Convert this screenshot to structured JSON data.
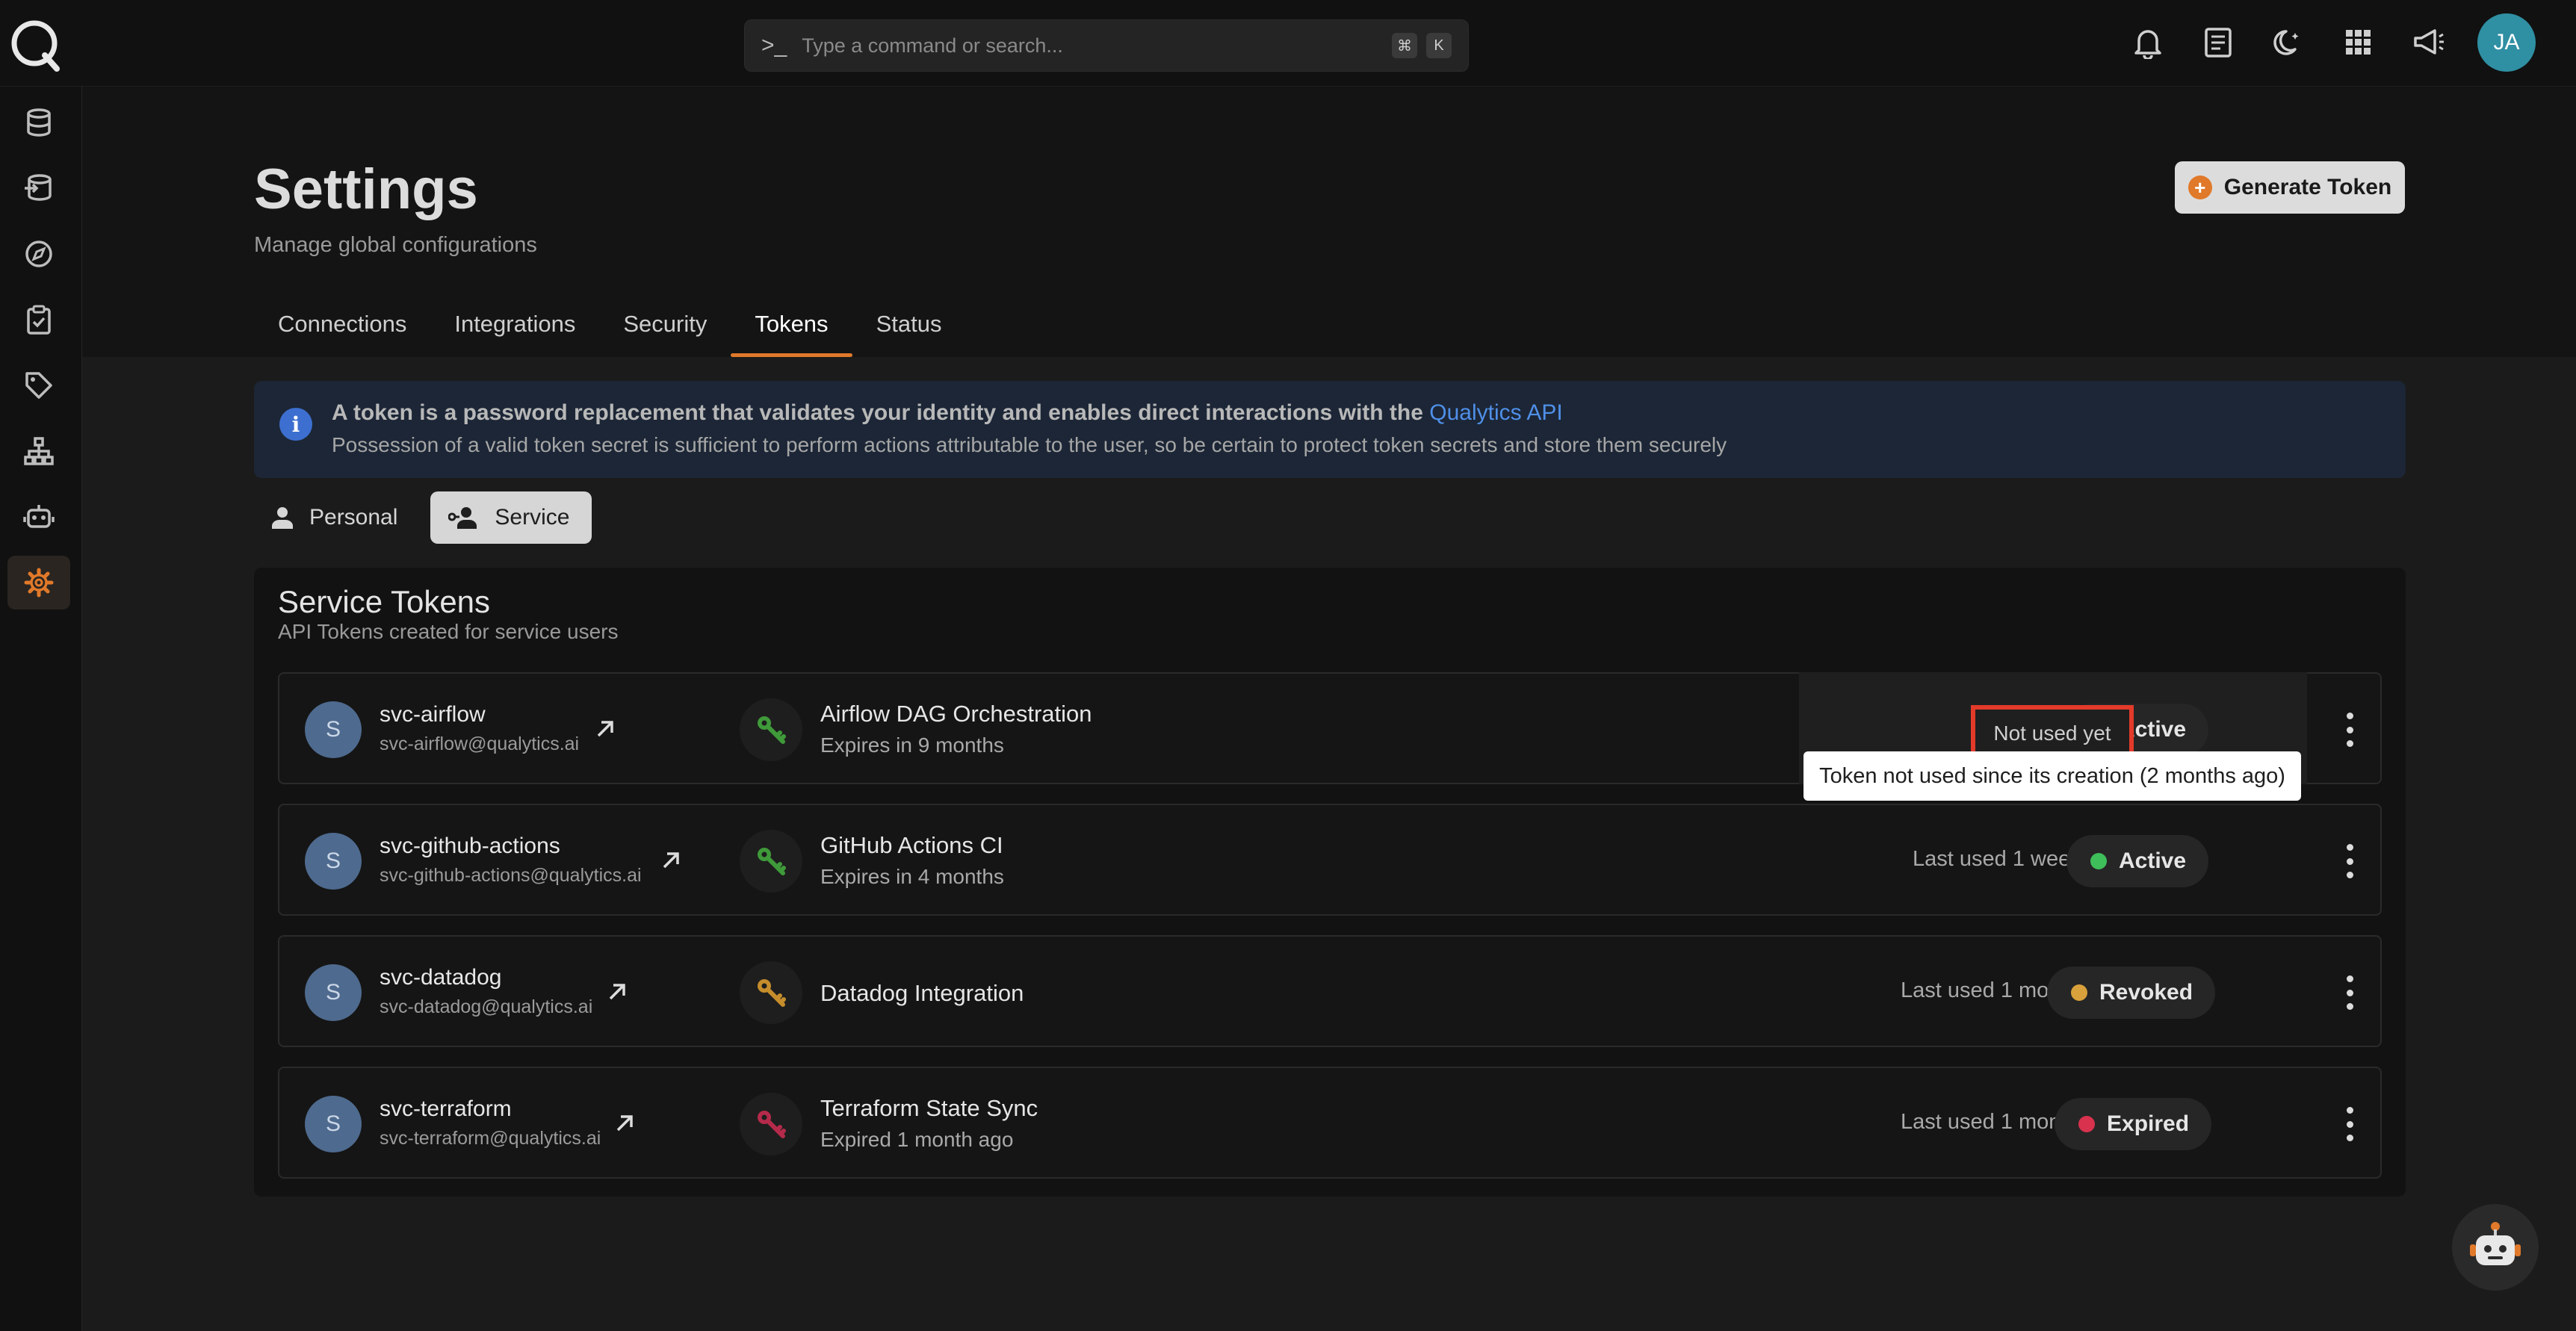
{
  "command_bar": {
    "placeholder": "Type a command or search...",
    "shortcut_mod": "⌘",
    "shortcut_key": "K"
  },
  "user": {
    "initials": "JA",
    "avatar_color": "#2f8fa3"
  },
  "accent_color": "#e0792a",
  "header": {
    "title": "Settings",
    "subtitle": "Manage global configurations",
    "generate_button": "Generate Token"
  },
  "tabs": [
    {
      "label": "Connections",
      "active": false
    },
    {
      "label": "Integrations",
      "active": false
    },
    {
      "label": "Security",
      "active": false
    },
    {
      "label": "Tokens",
      "active": true
    },
    {
      "label": "Status",
      "active": false
    }
  ],
  "info": {
    "line1": "A token is a password replacement that validates your identity and enables direct interactions with the",
    "link": "Qualytics API",
    "line2": "Possession of a valid token secret is sufficient to perform actions attributable to the user, so be certain to protect token secrets and store them securely"
  },
  "toggle": {
    "personal": "Personal",
    "service": "Service",
    "active": "Service"
  },
  "panel": {
    "title": "Service Tokens",
    "subtitle": "API Tokens created for service users"
  },
  "tokens": [
    {
      "avatar": "S",
      "name": "svc-airflow",
      "email": "svc-airflow@qualytics.ai",
      "token_name": "Airflow DAG Orchestration",
      "expires": "Expires in 9 months",
      "last_used": "Not used yet",
      "status": "Active",
      "status_color": "#3fbf5a",
      "key_color": "#3f9a3a"
    },
    {
      "avatar": "S",
      "name": "svc-github-actions",
      "email": "svc-github-actions@qualytics.ai",
      "token_name": "GitHub Actions CI",
      "expires": "Expires in 4 months",
      "last_used": "Last used 1 week ago",
      "status": "Active",
      "status_color": "#3fbf5a",
      "key_color": "#3f9a3a"
    },
    {
      "avatar": "S",
      "name": "svc-datadog",
      "email": "svc-datadog@qualytics.ai",
      "token_name": "Datadog Integration",
      "expires": "",
      "last_used": "Last used 1 month ago",
      "status": "Revoked",
      "status_color": "#d9a13b",
      "key_color": "#c58d2c"
    },
    {
      "avatar": "S",
      "name": "svc-terraform",
      "email": "svc-terraform@qualytics.ai",
      "token_name": "Terraform State Sync",
      "expires": "Expired 1 month ago",
      "last_used": "Last used 1 month ago",
      "status": "Expired",
      "status_color": "#d8324e",
      "key_color": "#b52a4a"
    }
  ],
  "tooltip": "Token not used since its creation (2 months ago)"
}
